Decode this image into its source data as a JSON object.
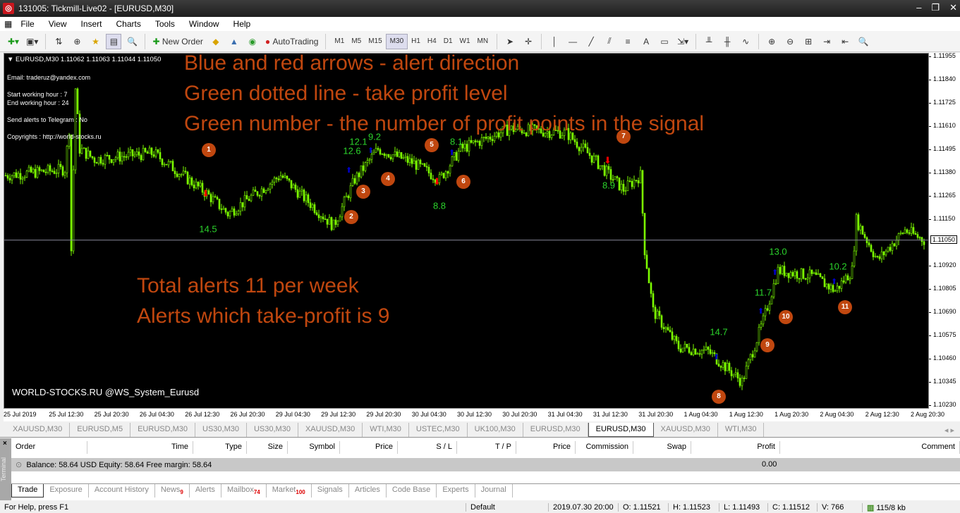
{
  "window": {
    "title": "131005: Tickmill-Live02 - [EURUSD,M30]"
  },
  "menu": [
    "File",
    "View",
    "Insert",
    "Charts",
    "Tools",
    "Window",
    "Help"
  ],
  "toolbar": {
    "new_order": "New Order",
    "autotrading": "AutoTrading",
    "timeframes": [
      "M1",
      "M5",
      "M15",
      "M30",
      "H1",
      "H4",
      "D1",
      "W1",
      "MN"
    ],
    "selected_timeframe": "M30"
  },
  "chart": {
    "header": "EURUSD,M30  1.11062 1.11063 1.11044 1.11050",
    "info": [
      "Email: traderuz@yandex.com",
      "Start working hour    : 7",
      "End working hour       : 24",
      "Send alerts to Telegram : No",
      "Copyrights : http://world-stocks.ru"
    ],
    "annotations": [
      "Blue and red arrows - alert direction",
      "Green dotted line - take profit level",
      "Green number - the number of profit points in the signal",
      "Total alerts 11 per week",
      "Alerts which take-profit is 9"
    ],
    "watermark": "WORLD-STOCKS.RU    @WS_System_Eurusd",
    "alert_numbers": [
      "1",
      "2",
      "3",
      "4",
      "5",
      "6",
      "7",
      "8",
      "9",
      "10",
      "11"
    ],
    "profit_points": [
      "14.5",
      "12.6",
      "12.1",
      "9.2",
      "8.1",
      "8.8",
      "8.9",
      "14.7",
      "11.7",
      "13.0",
      "10.2"
    ],
    "current_price": "1.11050",
    "price_ticks": [
      "1.11955",
      "1.11840",
      "1.11725",
      "1.11610",
      "1.11495",
      "1.11380",
      "1.11265",
      "1.11150",
      "1.10920",
      "1.10805",
      "1.10690",
      "1.10575",
      "1.10460",
      "1.10345",
      "1.10230"
    ],
    "time_ticks": [
      "25 Jul 2019",
      "25 Jul 12:30",
      "25 Jul 20:30",
      "26 Jul 04:30",
      "26 Jul 12:30",
      "26 Jul 20:30",
      "29 Jul 04:30",
      "29 Jul 12:30",
      "29 Jul 20:30",
      "30 Jul 04:30",
      "30 Jul 12:30",
      "30 Jul 20:30",
      "31 Jul 04:30",
      "31 Jul 12:30",
      "31 Jul 20:30",
      "1 Aug 04:30",
      "1 Aug 12:30",
      "1 Aug 20:30",
      "2 Aug 04:30",
      "2 Aug 12:30",
      "2 Aug 20:30"
    ],
    "colors": {
      "candle": "#7cfc00",
      "annotation": "#c0470f",
      "profit": "#2bd42b",
      "sell_arrow": "#ff0000",
      "buy_arrow": "#0000cc"
    }
  },
  "chart_tabs": [
    "XAUUSD,M30",
    "EURUSD,M5",
    "EURUSD,M30",
    "US30,M30",
    "US30,M30",
    "XAUUSD,M30",
    "WTI,M30",
    "USTEC,M30",
    "UK100,M30",
    "EURUSD,M30",
    "EURUSD,M30",
    "XAUUSD,M30",
    "WTI,M30"
  ],
  "terminal": {
    "side_label": "Terminal",
    "columns": [
      "Order",
      "Time",
      "Type",
      "Size",
      "Symbol",
      "Price",
      "S / L",
      "T / P",
      "Price",
      "Commission",
      "Swap",
      "Profit",
      "Comment"
    ],
    "balance": "Balance: 58.64 USD  Equity: 58.64  Free margin: 58.64",
    "profit": "0.00",
    "tabs": [
      {
        "label": "Trade"
      },
      {
        "label": "Exposure"
      },
      {
        "label": "Account History"
      },
      {
        "label": "News",
        "badge": "9"
      },
      {
        "label": "Alerts"
      },
      {
        "label": "Mailbox",
        "badge": "74"
      },
      {
        "label": "Market",
        "badge": "100"
      },
      {
        "label": "Signals"
      },
      {
        "label": "Articles"
      },
      {
        "label": "Code Base"
      },
      {
        "label": "Experts"
      },
      {
        "label": "Journal"
      }
    ]
  },
  "status": {
    "help": "For Help, press F1",
    "profile": "Default",
    "datetime": "2019.07.30 20:00",
    "open": "O: 1.11521",
    "high": "H: 1.11523",
    "low": "L: 1.11493",
    "close": "C: 1.11512",
    "volume": "V: 766",
    "traffic": "115/8 kb"
  }
}
